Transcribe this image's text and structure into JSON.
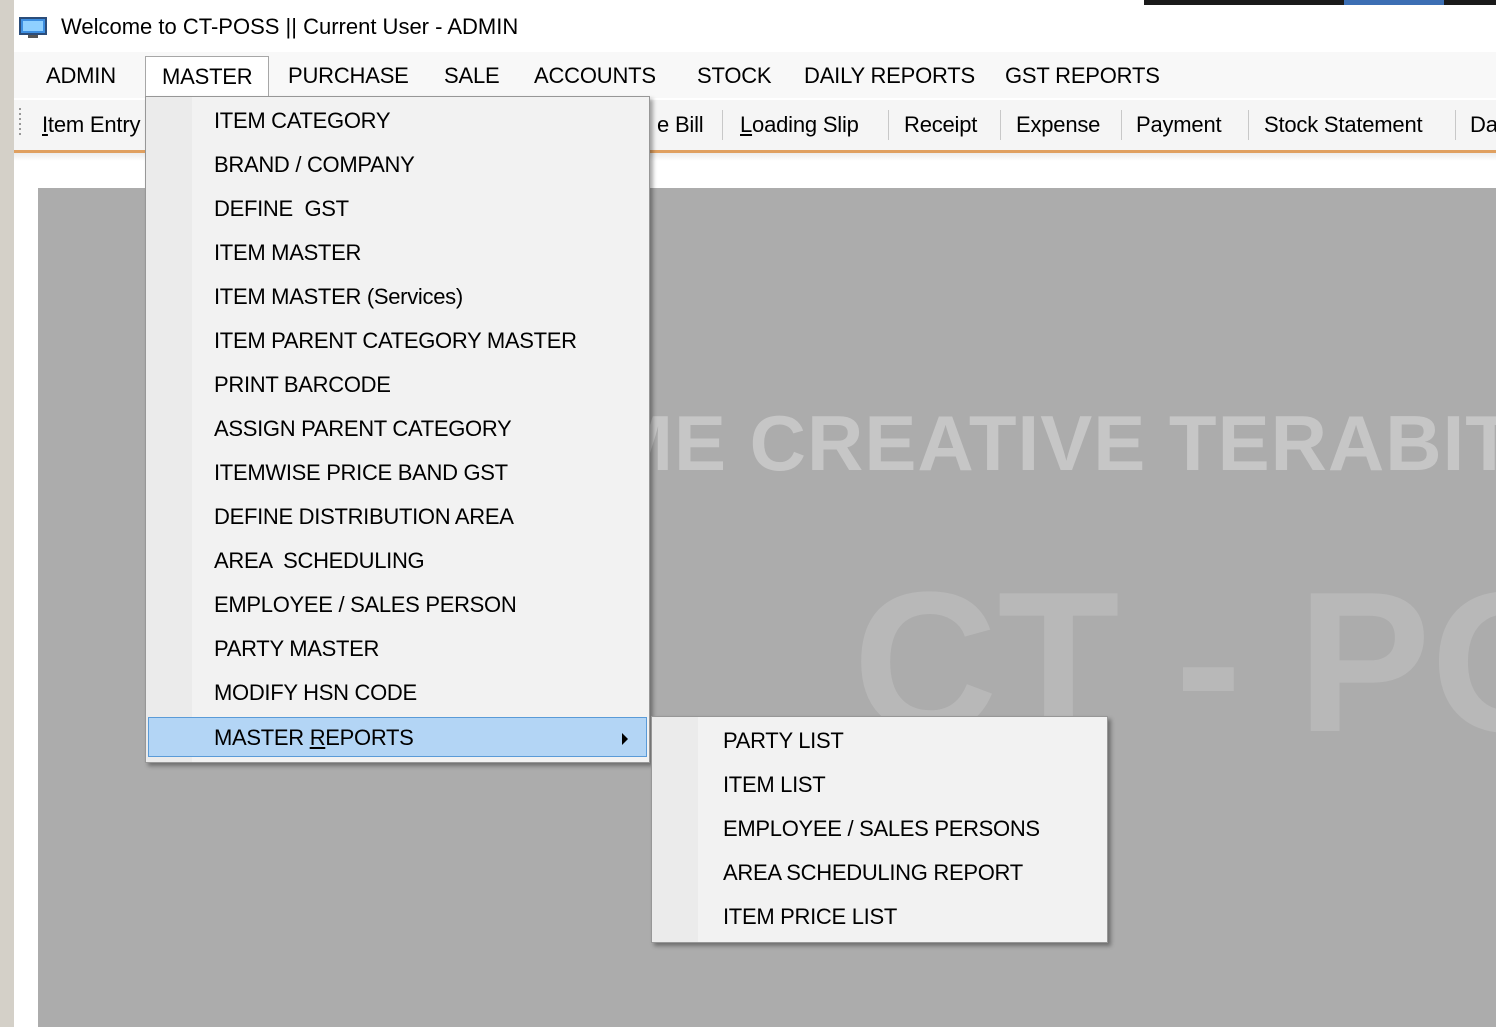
{
  "title": "Welcome to CT-POSS || Current User - ADMIN",
  "menubar": [
    {
      "label": "ADMIN"
    },
    {
      "label": "MASTER"
    },
    {
      "label": "PURCHASE"
    },
    {
      "label": "SALE"
    },
    {
      "label": "ACCOUNTS"
    },
    {
      "label": "STOCK"
    },
    {
      "label": "DAILY REPORTS"
    },
    {
      "label": "GST REPORTS"
    }
  ],
  "toolbar": [
    {
      "label": "Item Entry",
      "underline": "I",
      "rest": "tem Entry"
    },
    {
      "label": "e Bill"
    },
    {
      "label": "Loading Slip",
      "underline": "L",
      "rest": "oading Slip"
    },
    {
      "label": "Receipt"
    },
    {
      "label": "Expense"
    },
    {
      "label": "Payment"
    },
    {
      "label": "Stock Statement"
    },
    {
      "label": "Da"
    }
  ],
  "master_menu": [
    {
      "label": "ITEM CATEGORY"
    },
    {
      "label": "BRAND / COMPANY"
    },
    {
      "label": "DEFINE  GST"
    },
    {
      "label": "ITEM MASTER"
    },
    {
      "label": "ITEM MASTER (Services)"
    },
    {
      "label": "ITEM PARENT CATEGORY MASTER"
    },
    {
      "label": "PRINT BARCODE"
    },
    {
      "label": "ASSIGN PARENT CATEGORY"
    },
    {
      "label": "ITEMWISE PRICE BAND GST"
    },
    {
      "label": "DEFINE DISTRIBUTION AREA"
    },
    {
      "label": "AREA  SCHEDULING"
    },
    {
      "label": "EMPLOYEE / SALES PERSON"
    },
    {
      "label": "PARTY MASTER"
    },
    {
      "label": "MODIFY HSN CODE"
    },
    {
      "label": "MASTER REPORTS",
      "pre": "MASTER ",
      "underline": "R",
      "rest": "EPORTS"
    }
  ],
  "reports_submenu": [
    {
      "label": "PARTY LIST"
    },
    {
      "label": "ITEM LIST"
    },
    {
      "label": "EMPLOYEE / SALES PERSONS"
    },
    {
      "label": "AREA SCHEDULING REPORT"
    },
    {
      "label": "ITEM PRICE LIST"
    }
  ],
  "watermark": {
    "line1": "ME CREATIVE TERABITE",
    "line2": "CT - PO"
  },
  "colors": {
    "highlight": "#b3d5f5",
    "toolbar_accent": "#e0a060",
    "canvas": "#acacac"
  }
}
